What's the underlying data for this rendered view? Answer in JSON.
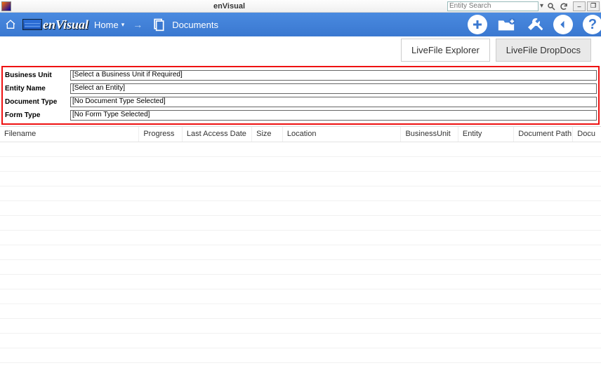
{
  "window": {
    "title": "enVisual",
    "search_placeholder": "Entity Search"
  },
  "nav": {
    "home_label": "Home",
    "breadcrumb": "Documents"
  },
  "tabs": {
    "explorer": "LiveFile Explorer",
    "dropdocs": "LiveFile DropDocs"
  },
  "filters": {
    "business_unit": {
      "label": "Business Unit",
      "value": "[Select a Business Unit if Required]"
    },
    "entity_name": {
      "label": "Entity Name",
      "value": "[Select an Entity]"
    },
    "document_type": {
      "label": "Document Type",
      "value": "[No Document Type Selected]"
    },
    "form_type": {
      "label": "Form Type",
      "value": "[No Form Type Selected]"
    }
  },
  "table": {
    "columns": [
      "Filename",
      "Progress",
      "Last Access Date",
      "Size",
      "Location",
      "BusinessUnit",
      "Entity",
      "Document Path",
      "Docu"
    ],
    "rows": []
  }
}
